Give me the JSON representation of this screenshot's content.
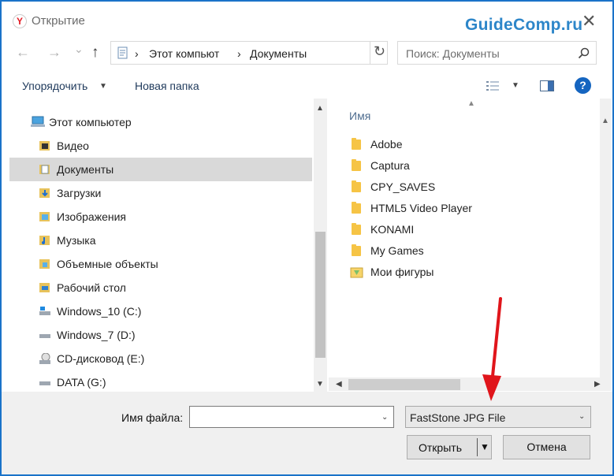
{
  "window": {
    "title": "Открытие",
    "app_logo": "Y",
    "watermark": "GuideComp.ru",
    "close_glyph": "✕"
  },
  "nav": {
    "back_glyph": "←",
    "forward_glyph": "→",
    "recent_glyph": "⌄",
    "up_glyph": "↑",
    "refresh_glyph": "↻"
  },
  "address": {
    "segments": [
      "Этот компьют",
      "Документы"
    ],
    "separator": "›"
  },
  "search": {
    "placeholder": "Поиск: Документы",
    "icon": "search-icon"
  },
  "toolbar": {
    "organize_label": "Упорядочить",
    "new_folder_label": "Новая папка",
    "help_label": "?"
  },
  "sidebar": {
    "items": [
      {
        "label": "Этот компьютер",
        "icon": "computer-icon"
      },
      {
        "label": "Видео",
        "icon": "video-folder-icon"
      },
      {
        "label": "Документы",
        "icon": "documents-folder-icon",
        "selected": true
      },
      {
        "label": "Загрузки",
        "icon": "downloads-folder-icon"
      },
      {
        "label": "Изображения",
        "icon": "pictures-folder-icon"
      },
      {
        "label": "Музыка",
        "icon": "music-folder-icon"
      },
      {
        "label": "Объемные объекты",
        "icon": "3d-objects-folder-icon"
      },
      {
        "label": "Рабочий стол",
        "icon": "desktop-folder-icon"
      },
      {
        "label": "Windows_10 (C:)",
        "icon": "system-drive-icon"
      },
      {
        "label": "Windows_7 (D:)",
        "icon": "drive-icon"
      },
      {
        "label": "CD-дисковод (E:)",
        "icon": "cd-drive-icon"
      },
      {
        "label": "DATA (G:)",
        "icon": "drive-icon"
      }
    ]
  },
  "files": {
    "column_header": "Имя",
    "items": [
      {
        "label": "Adobe",
        "icon": "folder-icon"
      },
      {
        "label": "Captura",
        "icon": "folder-icon"
      },
      {
        "label": "CPY_SAVES",
        "icon": "folder-icon"
      },
      {
        "label": "HTML5 Video Player",
        "icon": "folder-icon"
      },
      {
        "label": "KONAMI",
        "icon": "folder-icon"
      },
      {
        "label": "My Games",
        "icon": "folder-icon"
      },
      {
        "label": "Мои фигуры",
        "icon": "shapes-folder-icon"
      }
    ]
  },
  "footer": {
    "filename_label": "Имя файла:",
    "filename_value": "",
    "filetype_value": "FastStone JPG File",
    "open_label": "Открыть",
    "cancel_label": "Отмена"
  },
  "colors": {
    "accent_blue": "#1a73c9",
    "watermark_blue": "#2d86c9",
    "selection_gray": "#d9d9d9",
    "annotation_red": "#e0151b"
  }
}
